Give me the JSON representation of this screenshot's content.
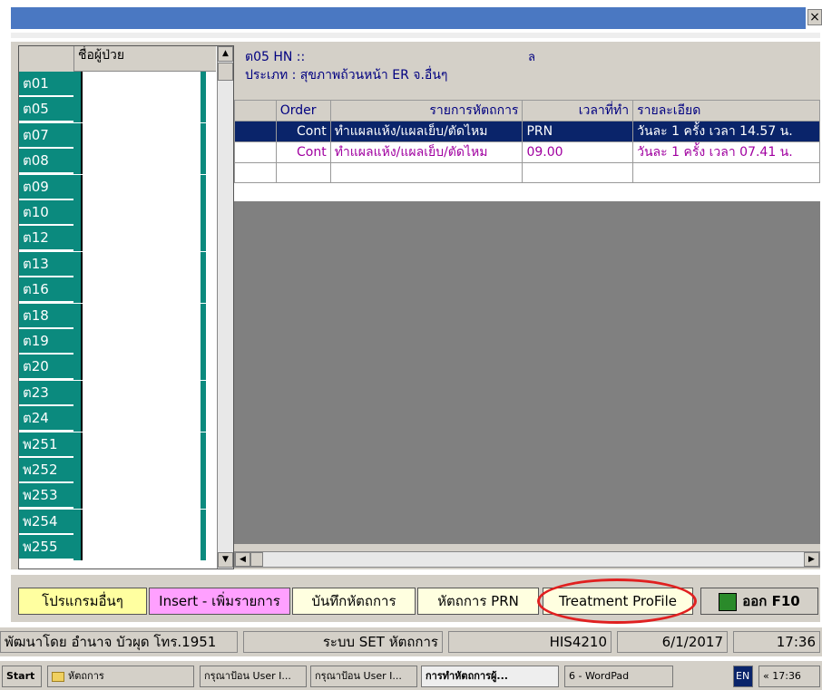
{
  "window": {
    "close_label": "×"
  },
  "patient_list": {
    "header": "ชื่อผู้ป่วย",
    "codes": [
      "ต01",
      "ต05",
      "ต07",
      "ต08",
      "ต09",
      "ต10",
      "ต12",
      "ต13",
      "ต16",
      "ต18",
      "ต19",
      "ต20",
      "ต23",
      "ต24",
      "พ251",
      "พ252",
      "พ253",
      "พ254",
      "พ255"
    ]
  },
  "info": {
    "line1": "ต05  HN ::",
    "line1_tail": "ล",
    "line2": "ประเภท : สุขภาพถ้วนหน้า ER จ.อื่นๆ"
  },
  "grid": {
    "columns": [
      "",
      "Order",
      "รายการหัตถการ",
      "เวลาที่ทำ",
      "รายละเอียด"
    ],
    "rows": [
      [
        "",
        "Cont",
        "ทำแผลแห้ง/แผลเย็บ/ตัดไหม",
        "PRN",
        "วันละ 1 ครั้ง เวลา 14.57 น."
      ],
      [
        "",
        "Cont",
        "ทำแผลแห้ง/แผลเย็บ/ตัดไหม",
        "09.00",
        "วันละ 1 ครั้ง เวลา 07.41 น."
      ]
    ]
  },
  "buttons": {
    "other_programs": "โปรแกรมอื่นๆ",
    "insert": "Insert - เพิ่มรายการ",
    "save": "บันทึกหัตถการ",
    "prn": "หัตถการ PRN",
    "treatment_profile": "Treatment ProFile",
    "exit": "ออก F10"
  },
  "status": {
    "developer": "พัฒนาโดย  อำนาจ  บัวผุด โทร.1951",
    "system": "ระบบ SET หัตถการ",
    "code": "HIS4210",
    "date": "6/1/2017",
    "time": "17:36"
  },
  "taskbar": {
    "start": "Start",
    "items": [
      "หัตถการ",
      "กรุณาป้อน User I...",
      "กรุณาป้อน User I...",
      "การทำหัตถการผู้...",
      "6 - WordPad"
    ],
    "lang": "EN",
    "clock": "17:36",
    "chevron": "«"
  },
  "colors": {
    "titlebar": "#4a78c2",
    "list_bg": "#0b8a7e",
    "selected_row": "#0a246a",
    "highlight_oval": "#e02020"
  }
}
